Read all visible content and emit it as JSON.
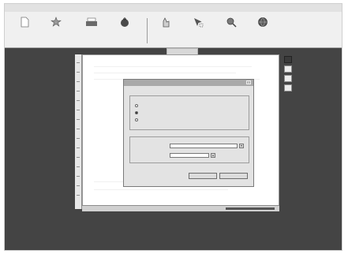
{
  "window": {
    "title": ""
  },
  "toolbar": {
    "items": [
      {
        "label": "",
        "icon": "new-file-icon"
      },
      {
        "label": "",
        "icon": "star-icon"
      },
      {
        "label": "",
        "icon": "printer-icon"
      },
      {
        "label": "",
        "icon": "magic-wand-icon"
      },
      {
        "label": "",
        "icon": "hand-icon"
      },
      {
        "label": "",
        "icon": "cursor-select-icon"
      },
      {
        "label": "",
        "icon": "zoom-icon"
      },
      {
        "label": "",
        "icon": "globe-icon"
      }
    ]
  },
  "document": {
    "page_label": ""
  },
  "status": {
    "left_text": "",
    "zoom_text": ""
  },
  "dialog": {
    "title": "",
    "group1": {
      "title": "",
      "options": [
        "",
        "",
        ""
      ],
      "selected": 1
    },
    "group2": {
      "title": "",
      "field1_label": "",
      "field1_value": "",
      "field2_label": "",
      "field2_value": ""
    },
    "ok_label": "",
    "cancel_label": ""
  },
  "colors": {
    "workspace": "#444444",
    "toolbar": "#f0f0f0",
    "dialog": "#e3e3e3",
    "dialog_title": "#a9a9a9"
  }
}
